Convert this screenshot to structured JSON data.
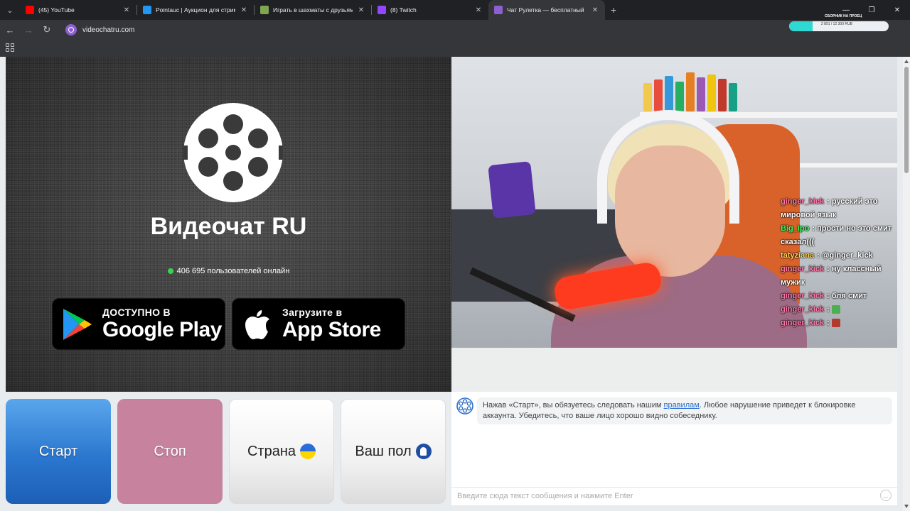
{
  "browser": {
    "tabs": [
      {
        "title": "(45) YouTube",
        "color": "#ff0000"
      },
      {
        "title": "Pointauc | Аукцион для стримеров",
        "color": "#2196f3"
      },
      {
        "title": "Играть в шахматы с друзьями",
        "color": "#7fa650"
      },
      {
        "title": "(8) Twitch",
        "color": "#9146ff"
      },
      {
        "title": "Чат Рулетка — бесплатный",
        "color": "#8e5fd1",
        "active": true
      }
    ],
    "url": "videochatru.com",
    "extension": {
      "title": "СБОРНИК НА ПРОЕЦ",
      "progress_text": "2 891 / 12 300 RUB",
      "progress_fraction": 0.235
    }
  },
  "hero": {
    "brand": "Видеочат RU",
    "online_count": "406 695 пользователей онлайн",
    "google_play": {
      "small": "ДОСТУПНО В",
      "big": "Google Play"
    },
    "app_store": {
      "small": "Загрузите в",
      "big": "App Store"
    }
  },
  "stream_chat": [
    {
      "user": "ginger_kick",
      "color": "#ff7aa8",
      "text": "русский это мировой язык"
    },
    {
      "user": "Big_Ipo",
      "color": "#39ff5a",
      "text": "прости но это смит сказал((("
    },
    {
      "user": "tatyziana",
      "color": "#ffd45a",
      "text": "@ginger_kick"
    },
    {
      "user": "ginger_kick",
      "color": "#ff7aa8",
      "text": "ну классный мужик"
    },
    {
      "user": "ginger_kick",
      "color": "#ff7aa8",
      "text": "бля смит"
    },
    {
      "user": "ginger_kick",
      "color": "#ff7aa8",
      "text": ""
    },
    {
      "user": "ginger_kick",
      "color": "#ff7aa8",
      "text": ""
    }
  ],
  "controls": {
    "start": "Старт",
    "stop": "Стоп",
    "country": "Страна",
    "gender": "Ваш пол"
  },
  "chatbox": {
    "system_before": "Нажав «Старт», вы обязуетесь следовать нашим ",
    "system_link": "правилам",
    "system_after": ". Любое нарушение приведет к блокировке аккаунта. Убедитесь, что ваше лицо хорошо видно собеседнику.",
    "input_placeholder": "Введите сюда текст сообщения и нажмите Enter"
  }
}
